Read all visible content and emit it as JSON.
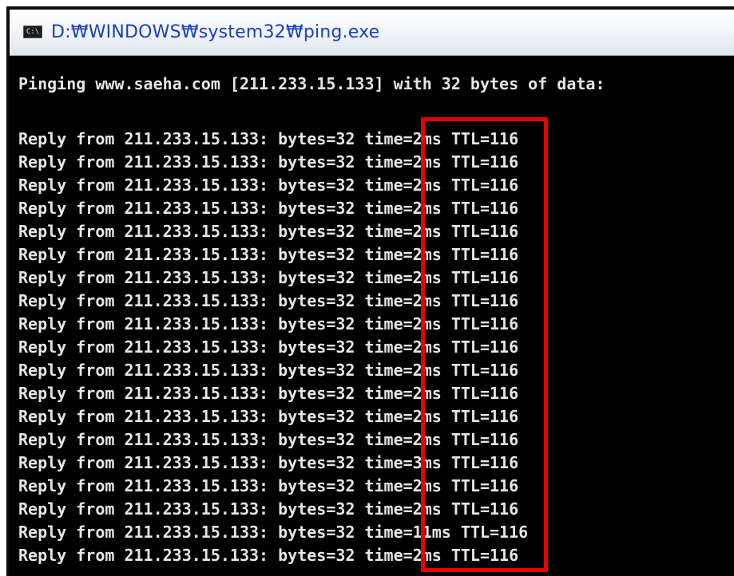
{
  "window": {
    "title": "D:\\WINDOWS\\system32\\ping.exe",
    "title_display": "D:₩WINDOWS₩system32₩ping.exe",
    "icon": "console-icon",
    "icon_glyph": "C:\\"
  },
  "console": {
    "header": "Pinging www.saeha.com [211.233.15.133] with 32 bytes of data:",
    "lines": [
      "Reply from 211.233.15.133: bytes=32 time=2ms TTL=116",
      "Reply from 211.233.15.133: bytes=32 time=2ms TTL=116",
      "Reply from 211.233.15.133: bytes=32 time=2ms TTL=116",
      "Reply from 211.233.15.133: bytes=32 time=2ms TTL=116",
      "Reply from 211.233.15.133: bytes=32 time=2ms TTL=116",
      "Reply from 211.233.15.133: bytes=32 time=2ms TTL=116",
      "Reply from 211.233.15.133: bytes=32 time=2ms TTL=116",
      "Reply from 211.233.15.133: bytes=32 time=2ms TTL=116",
      "Reply from 211.233.15.133: bytes=32 time=2ms TTL=116",
      "Reply from 211.233.15.133: bytes=32 time=2ms TTL=116",
      "Reply from 211.233.15.133: bytes=32 time=2ms TTL=116",
      "Reply from 211.233.15.133: bytes=32 time=2ms TTL=116",
      "Reply from 211.233.15.133: bytes=32 time=2ms TTL=116",
      "Reply from 211.233.15.133: bytes=32 time=2ms TTL=116",
      "Reply from 211.233.15.133: bytes=32 time=3ms TTL=116",
      "Reply from 211.233.15.133: bytes=32 time=2ms TTL=116",
      "Reply from 211.233.15.133: bytes=32 time=2ms TTL=116",
      "Reply from 211.233.15.133: bytes=32 time=11ms TTL=116",
      "Reply from 211.233.15.133: bytes=32 time=2ms TTL=116"
    ]
  },
  "colors": {
    "console_bg": "#000000",
    "console_text": "#e6e6e6",
    "title_text": "#1a3fbf",
    "highlight": "#e60000"
  }
}
